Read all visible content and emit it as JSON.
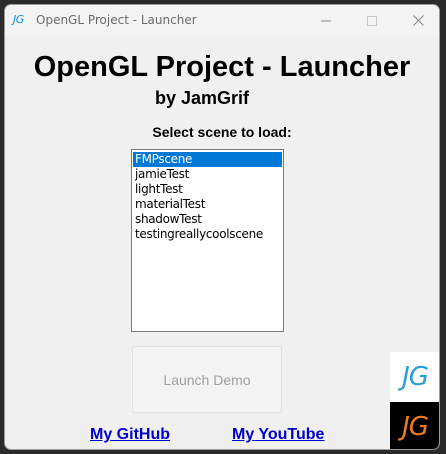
{
  "window": {
    "title": "OpenGL Project - Launcher",
    "icon_text": "JG"
  },
  "titlebar_buttons": [
    {
      "name": "minimize",
      "icon": "minimize-icon"
    },
    {
      "name": "maximize",
      "icon": "maximize-icon",
      "disabled": true
    },
    {
      "name": "close",
      "icon": "close-icon"
    }
  ],
  "main": {
    "heading": "OpenGL Project - Launcher",
    "byline": "by JamGrif",
    "select_label": "Select scene to load:",
    "scenes": [
      {
        "label": "FMPscene",
        "selected": true
      },
      {
        "label": "jamieTest",
        "selected": false
      },
      {
        "label": "lightTest",
        "selected": false
      },
      {
        "label": "materialTest",
        "selected": false
      },
      {
        "label": "shadowTest",
        "selected": false
      },
      {
        "label": "testingreallycoolscene",
        "selected": false
      }
    ],
    "launch_button": "Launch Demo",
    "links": {
      "github": "My GitHub",
      "youtube": "My YouTube"
    },
    "logos": {
      "light": "JG",
      "dark": "JG"
    }
  },
  "colors": {
    "selection": "#0078d7",
    "link": "#0000cc",
    "logo_light_text": "#2a9fd6",
    "logo_dark_text": "#f07c1e",
    "window_bg": "#f0f0f0"
  }
}
